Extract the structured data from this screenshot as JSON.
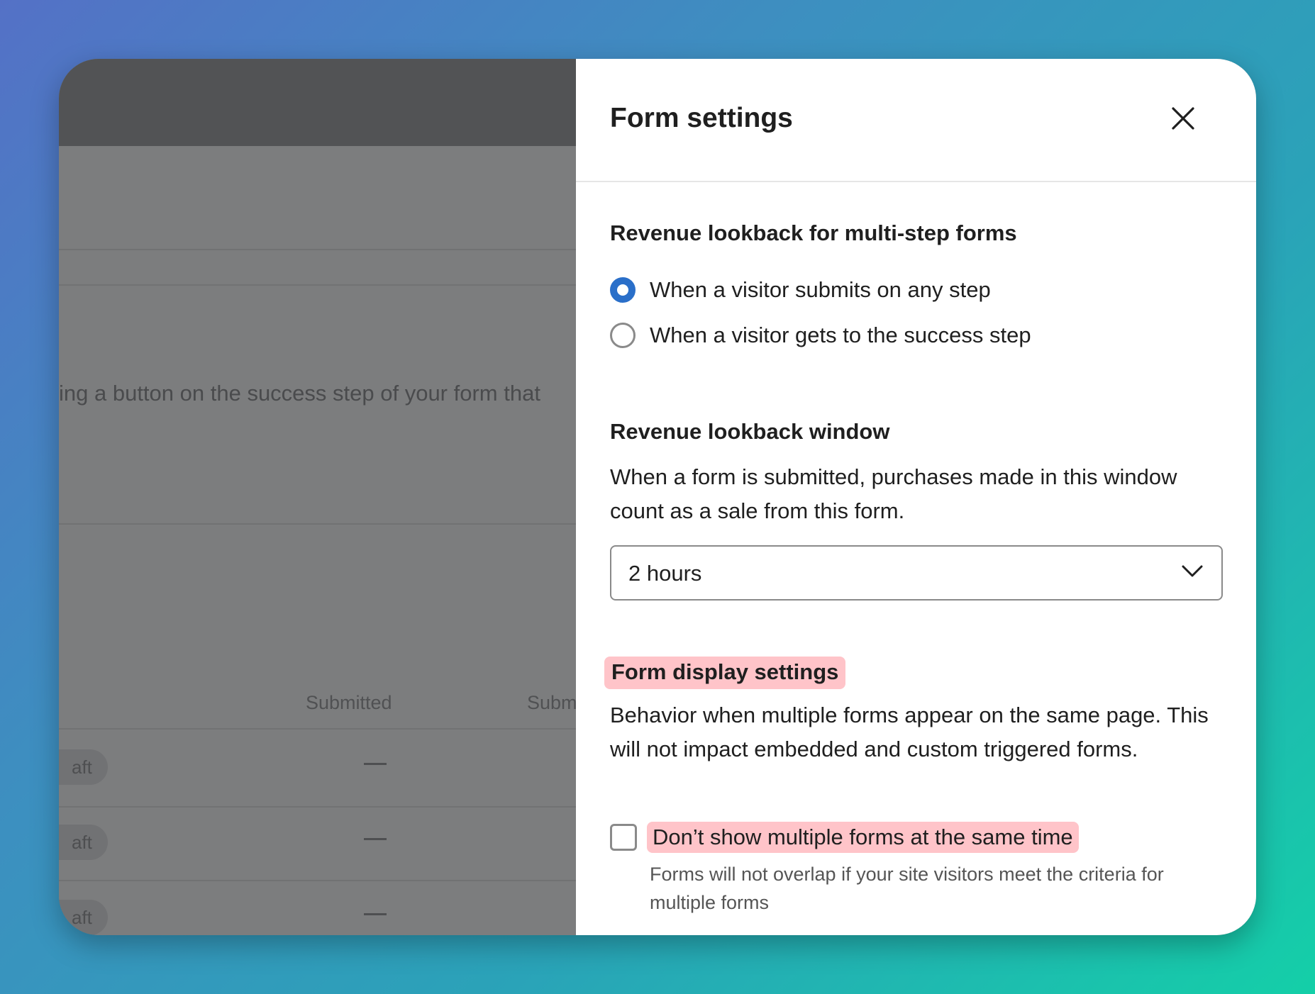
{
  "background": {
    "partial_text": "ing a button on the success step of your form that",
    "table_headers": [
      "Submitted",
      "Subm"
    ],
    "rows": [
      {
        "status": "aft",
        "value": "—"
      },
      {
        "status": "aft",
        "value": "—"
      },
      {
        "status": "aft",
        "value": "—"
      }
    ]
  },
  "panel": {
    "title": "Form settings",
    "close_icon": "close-icon",
    "multi_step": {
      "title": "Revenue lookback for multi-step forms",
      "options": [
        {
          "label": "When a visitor submits on any step",
          "selected": true
        },
        {
          "label": "When a visitor gets to the success step",
          "selected": false
        }
      ]
    },
    "window": {
      "title": "Revenue lookback window",
      "description": "When a form is submitted, purchases made in this window count as a sale from this form.",
      "selected_value": "2 hours"
    },
    "display": {
      "title": "Form display settings",
      "description": "Behavior when multiple forms appear on the same page. This will not impact embedded and custom triggered forms.",
      "checkbox_label": "Don’t show multiple forms at the same time",
      "checkbox_checked": false,
      "helper": "Forms will not overlap if your site visitors meet the criteria for multiple forms"
    }
  },
  "colors": {
    "accent": "#2a6fc9",
    "highlight": "#ffc4c9",
    "overlay": "#7c7d7e"
  }
}
